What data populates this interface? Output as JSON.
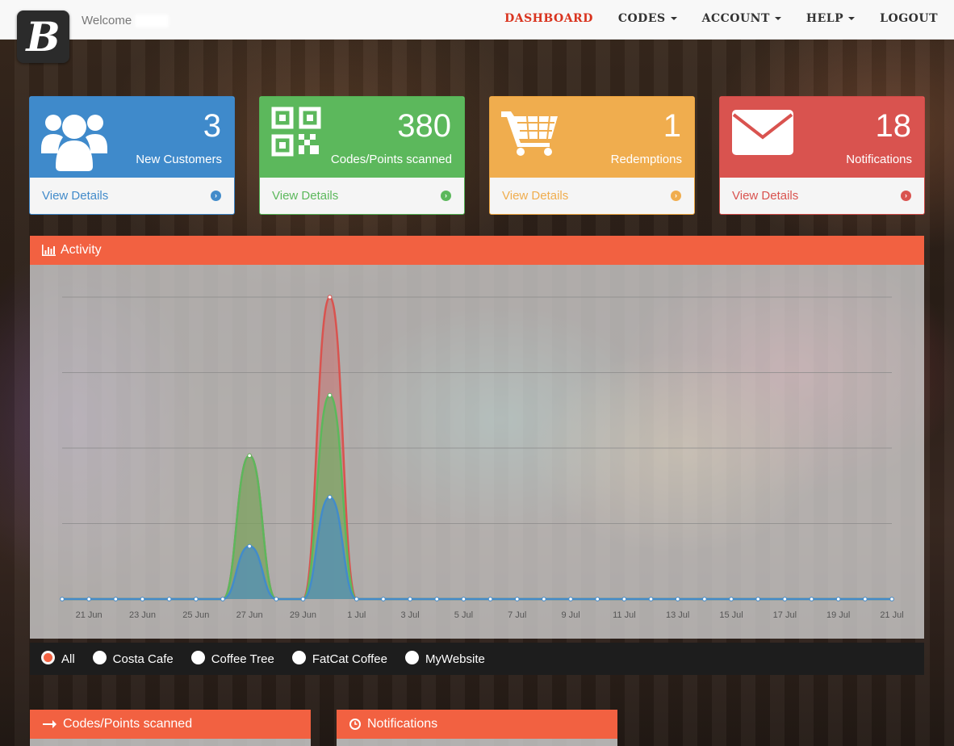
{
  "header": {
    "logo_letter": "B",
    "welcome": "Welcome",
    "nav": [
      {
        "label": "DASHBOARD",
        "dropdown": false,
        "active": true
      },
      {
        "label": "CODES",
        "dropdown": true,
        "active": false
      },
      {
        "label": "ACCOUNT",
        "dropdown": true,
        "active": false
      },
      {
        "label": "HELP",
        "dropdown": true,
        "active": false
      },
      {
        "label": "LOGOUT",
        "dropdown": false,
        "active": false
      }
    ]
  },
  "stats": [
    {
      "value": "3",
      "label": "New Customers",
      "link": "View Details",
      "icon": "users-icon",
      "color": "#3f8acb"
    },
    {
      "value": "380",
      "label": "Codes/Points scanned",
      "link": "View Details",
      "icon": "qrcode-icon",
      "color": "#5cb85c"
    },
    {
      "value": "1",
      "label": "Redemptions",
      "link": "View Details",
      "icon": "cart-icon",
      "color": "#f0ad4e"
    },
    {
      "value": "18",
      "label": "Notifications",
      "link": "View Details",
      "icon": "envelope-icon",
      "color": "#d9534f"
    }
  ],
  "activity": {
    "title": "Activity",
    "icon": "bar-chart-icon",
    "filters": [
      {
        "label": "All",
        "selected": true
      },
      {
        "label": "Costa Cafe",
        "selected": false
      },
      {
        "label": "Coffee Tree",
        "selected": false
      },
      {
        "label": "FatCat Coffee",
        "selected": false
      },
      {
        "label": "MyWebsite",
        "selected": false
      }
    ]
  },
  "chart_data": {
    "type": "area",
    "x": [
      "20 Jun",
      "21 Jun",
      "22 Jun",
      "23 Jun",
      "24 Jun",
      "25 Jun",
      "26 Jun",
      "27 Jun",
      "28 Jun",
      "29 Jun",
      "30 Jun",
      "1 Jul",
      "2 Jul",
      "3 Jul",
      "4 Jul",
      "5 Jul",
      "6 Jul",
      "7 Jul",
      "8 Jul",
      "9 Jul",
      "10 Jul",
      "11 Jul",
      "12 Jul",
      "13 Jul",
      "14 Jul",
      "15 Jul",
      "16 Jul",
      "17 Jul",
      "18 Jul",
      "19 Jul",
      "20 Jul",
      "21 Jul"
    ],
    "tick_labels": [
      "21 Jun",
      "23 Jun",
      "25 Jun",
      "27 Jun",
      "29 Jun",
      "1 Jul",
      "3 Jul",
      "5 Jul",
      "7 Jul",
      "9 Jul",
      "11 Jul",
      "13 Jul",
      "15 Jul",
      "17 Jul",
      "19 Jul",
      "21 Jul"
    ],
    "ylim": [
      0,
      4
    ],
    "gridlines": [
      1,
      2,
      3,
      4
    ],
    "grid": true,
    "series": [
      {
        "color": "#d9534f",
        "values": [
          0,
          0,
          0,
          0,
          0,
          0,
          0,
          1.9,
          0,
          0,
          4,
          0,
          0,
          0,
          0,
          0,
          0,
          0,
          0,
          0,
          0,
          0,
          0,
          0,
          0,
          0,
          0,
          0,
          0,
          0,
          0,
          0
        ]
      },
      {
        "color": "#5cb85c",
        "values": [
          0,
          0,
          0,
          0,
          0,
          0,
          0,
          1.9,
          0,
          0,
          2.7,
          0,
          0,
          0,
          0,
          0,
          0,
          0,
          0,
          0,
          0,
          0,
          0,
          0,
          0,
          0,
          0,
          0,
          0,
          0,
          0,
          0
        ]
      },
      {
        "color": "#428bca",
        "values": [
          0,
          0,
          0,
          0,
          0,
          0,
          0,
          0.7,
          0,
          0,
          1.35,
          0,
          0,
          0,
          0,
          0,
          0,
          0,
          0,
          0,
          0,
          0,
          0,
          0,
          0,
          0,
          0,
          0,
          0,
          0,
          0,
          0
        ]
      }
    ]
  },
  "bottom_panels": [
    {
      "title": "Codes/Points scanned",
      "icon": "arrow-right-icon"
    },
    {
      "title": "Notifications",
      "icon": "clock-icon"
    }
  ]
}
